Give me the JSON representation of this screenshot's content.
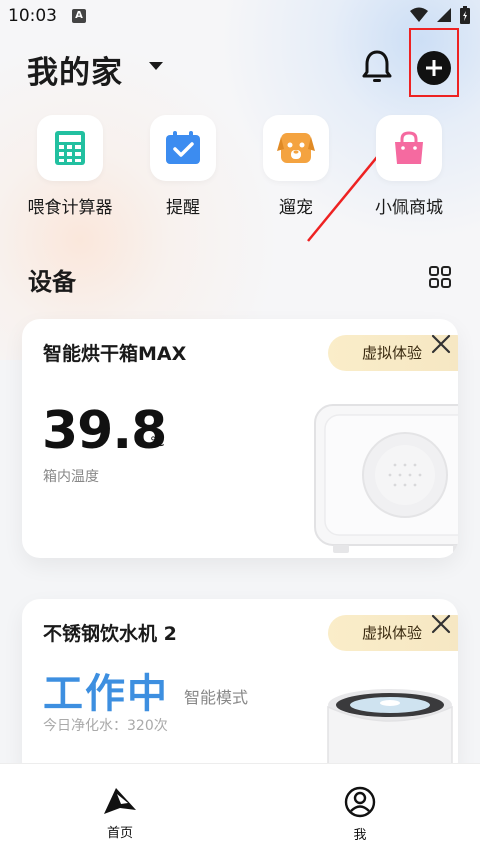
{
  "status_bar": {
    "time": "10:03",
    "notification_badge": "A"
  },
  "header": {
    "title": "我的家"
  },
  "quick_actions": [
    {
      "label": "喂食计算器",
      "icon": "calculator-icon",
      "color": "#22c0a0"
    },
    {
      "label": "提醒",
      "icon": "calendar-check-icon",
      "color": "#3c8cf0"
    },
    {
      "label": "遛宠",
      "icon": "dog-face-icon",
      "color": "#f4a340"
    },
    {
      "label": "小佩商城",
      "icon": "shopping-bag-icon",
      "color": "#f56aa0"
    }
  ],
  "devices": {
    "title": "设备",
    "cards": [
      {
        "name": "智能烘干箱MAX",
        "badge": "虚拟体验",
        "reading_value": "39.8",
        "reading_unit": "℃",
        "reading_label": "箱内温度"
      },
      {
        "name": "不锈钢饮水机 2",
        "badge": "虚拟体验",
        "status": "工作中",
        "mode": "智能模式",
        "purify": "今日净化水：320次"
      }
    ]
  },
  "bottom_nav": {
    "home_label": "首页",
    "me_label": "我"
  },
  "colors": {
    "accent_blue": "#3d8fe0",
    "badge_bg": "#faedc9",
    "highlight_red": "#e22222"
  }
}
